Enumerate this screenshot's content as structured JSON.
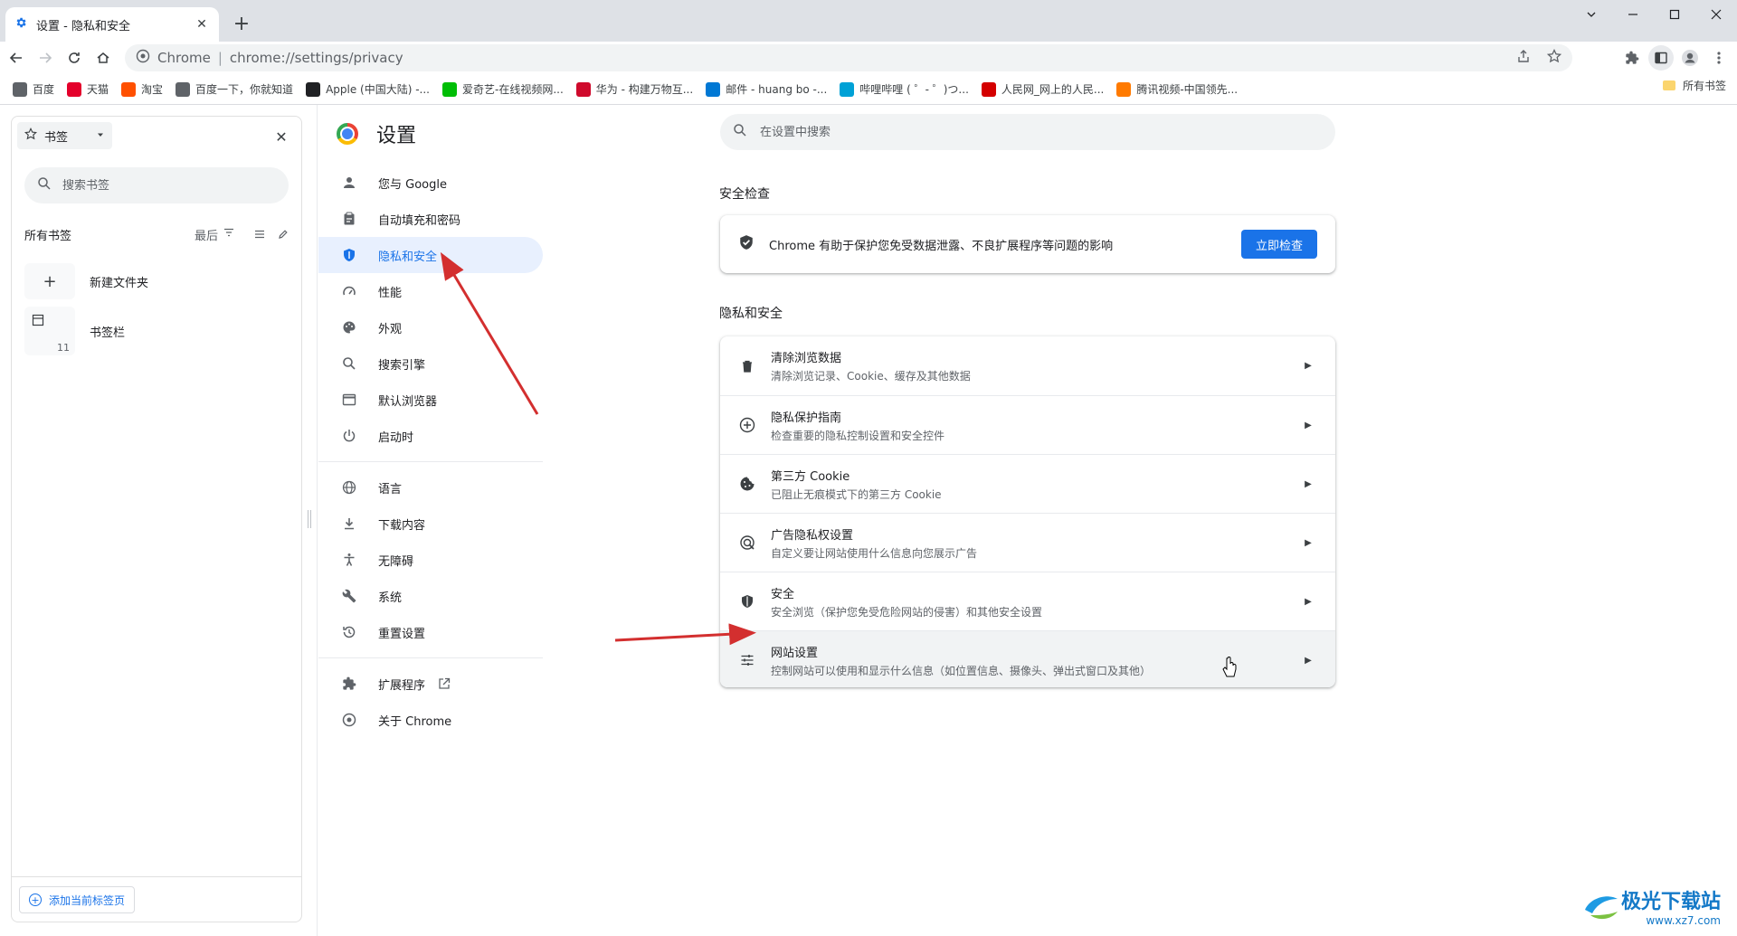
{
  "tab": {
    "title": "设置 - 隐私和安全"
  },
  "toolbar": {
    "site_name": "Chrome",
    "url": "chrome://settings/privacy"
  },
  "bookmarks_bar": {
    "items": [
      {
        "label": "百度",
        "color": "#5f6368"
      },
      {
        "label": "天猫",
        "color": "#e4002b"
      },
      {
        "label": "淘宝",
        "color": "#ff5000"
      },
      {
        "label": "百度一下，你就知道",
        "color": "#5f6368"
      },
      {
        "label": "Apple (中国大陆) -...",
        "color": "#202124"
      },
      {
        "label": "爱奇艺-在线视频网...",
        "color": "#00be06"
      },
      {
        "label": "华为 - 构建万物互...",
        "color": "#cf0a2c"
      },
      {
        "label": "邮件 - huang bo -...",
        "color": "#0078d4"
      },
      {
        "label": "哔哩哔哩 ( ゜- ゜)つ...",
        "color": "#00a1d6"
      },
      {
        "label": "人民网_网上的人民...",
        "color": "#d40000"
      },
      {
        "label": "腾讯视频-中国领先...",
        "color": "#ff7a00"
      }
    ],
    "all_label": "所有书签"
  },
  "side_panel": {
    "selector_label": "书签",
    "search_placeholder": "搜索书签",
    "section_title": "所有书签",
    "sort_label": "最后",
    "rows": [
      {
        "name": "新建文件夹",
        "count": ""
      },
      {
        "name": "书签栏",
        "count": "11"
      }
    ],
    "add_label": "添加当前标签页"
  },
  "settings": {
    "title": "设置",
    "nav": [
      {
        "label": "您与 Google",
        "icon": "person-icon"
      },
      {
        "label": "自动填充和密码",
        "icon": "clipboard-icon"
      },
      {
        "label": "隐私和安全",
        "icon": "shield-icon",
        "active": true
      },
      {
        "label": "性能",
        "icon": "speedometer-icon"
      },
      {
        "label": "外观",
        "icon": "palette-icon"
      },
      {
        "label": "搜索引擎",
        "icon": "search-icon"
      },
      {
        "label": "默认浏览器",
        "icon": "browser-icon"
      },
      {
        "label": "启动时",
        "icon": "power-icon"
      },
      {
        "label": "语言",
        "icon": "globe-icon"
      },
      {
        "label": "下载内容",
        "icon": "download-icon"
      },
      {
        "label": "无障碍",
        "icon": "accessibility-icon"
      },
      {
        "label": "系统",
        "icon": "wrench-icon"
      },
      {
        "label": "重置设置",
        "icon": "history-icon"
      },
      {
        "label": "扩展程序",
        "icon": "puzzle-icon"
      },
      {
        "label": "关于 Chrome",
        "icon": "chrome-icon"
      }
    ],
    "search_placeholder": "在设置中搜索",
    "safety_check": {
      "section": "安全检查",
      "text": "Chrome 有助于保护您免受数据泄露、不良扩展程序等问题的影响",
      "button": "立即检查"
    },
    "privacy": {
      "section": "隐私和安全",
      "rows": [
        {
          "title": "清除浏览数据",
          "subtitle": "清除浏览记录、Cookie、缓存及其他数据",
          "icon": "trash-icon"
        },
        {
          "title": "隐私保护指南",
          "subtitle": "检查重要的隐私控制设置和安全控件",
          "icon": "compass-plus-icon"
        },
        {
          "title": "第三方 Cookie",
          "subtitle": "已阻止无痕模式下的第三方 Cookie",
          "icon": "cookie-icon"
        },
        {
          "title": "广告隐私权设置",
          "subtitle": "自定义要让网站使用什么信息向您展示广告",
          "icon": "ad-privacy-icon"
        },
        {
          "title": "安全",
          "subtitle": "安全浏览（保护您免受危险网站的侵害）和其他安全设置",
          "icon": "shield-icon"
        },
        {
          "title": "网站设置",
          "subtitle": "控制网站可以使用和显示什么信息（如位置信息、摄像头、弹出式窗口及其他）",
          "icon": "tune-icon"
        }
      ]
    }
  },
  "watermark": {
    "line1": "极光下载站",
    "line2": "www.xz7.com"
  },
  "colors": {
    "accent": "#1a73e8",
    "annotation_arrow": "#d32f2f"
  }
}
